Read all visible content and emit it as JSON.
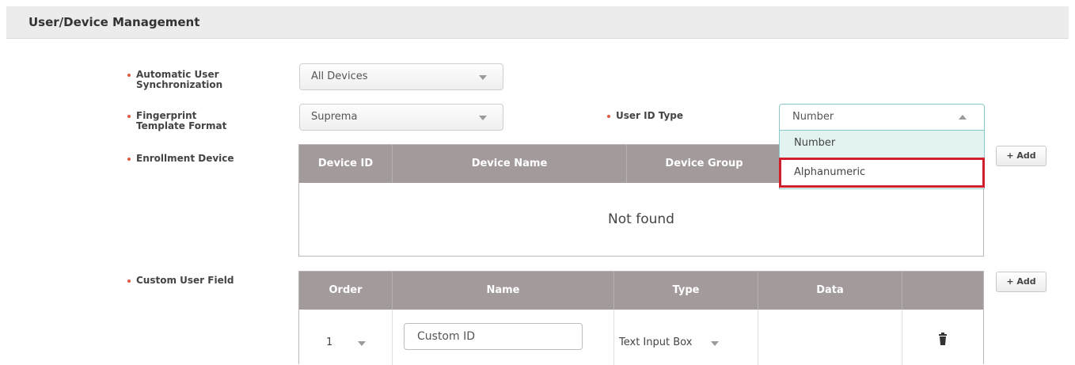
{
  "section": {
    "title": "User/Device Management"
  },
  "fields": {
    "auto_sync": {
      "label_line1": "Automatic User",
      "label_line2": "Synchronization",
      "value": "All Devices"
    },
    "fp_format": {
      "label_line1": "Fingerprint",
      "label_line2": "Template Format",
      "value": "Suprema"
    },
    "user_id_type": {
      "label": "User ID Type",
      "value": "Number",
      "options": [
        "Number",
        "Alphanumeric"
      ]
    },
    "enrollment_device": {
      "label": "Enrollment Device"
    },
    "custom_user_field": {
      "label": "Custom User Field"
    }
  },
  "enrollment_table": {
    "columns": [
      "Device ID",
      "Device Name",
      "Device Group",
      ""
    ],
    "empty_message": "Not found",
    "add_label": "+ Add"
  },
  "custom_table": {
    "columns": [
      "Order",
      "Name",
      "Type",
      "Data",
      ""
    ],
    "add_label": "+ Add",
    "rows": [
      {
        "order": "1",
        "name": "Custom ID",
        "type": "Text Input Box",
        "data": ""
      }
    ]
  },
  "colors": {
    "header_bg": "#a39b9b",
    "required_dot": "#e2593f",
    "highlight_border": "#d11f2c",
    "focus_border": "#8cc9c6"
  },
  "icons": [
    "chevron-down-icon",
    "chevron-up-icon",
    "trash-icon"
  ]
}
